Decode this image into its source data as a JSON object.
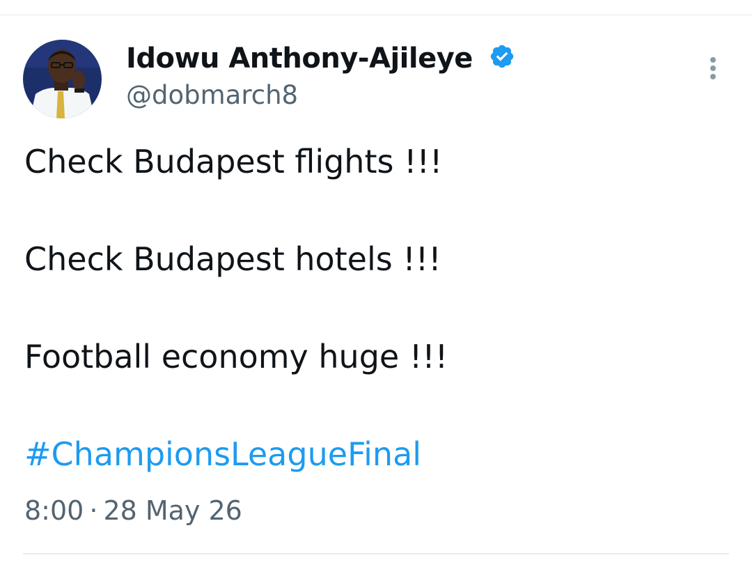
{
  "tweet": {
    "author": {
      "display_name": "Idowu Anthony-Ajileye",
      "handle": "@dobmarch8",
      "verified": true,
      "avatar_icon": "profile-photo"
    },
    "body_lines": [
      "Check Budapest flights !!!",
      "Check Budapest hotels !!!",
      "Football economy huge !!!"
    ],
    "hashtag": "#ChampionsLeagueFinal",
    "time": "8:00",
    "date": "28 May 26",
    "separator": "·",
    "more_icon": "more-vertical-icon"
  },
  "colors": {
    "text": "#0f1419",
    "secondary": "#536471",
    "link": "#1d9bf0",
    "verified": "#1d9bf0",
    "divider": "#e1e6ea"
  }
}
